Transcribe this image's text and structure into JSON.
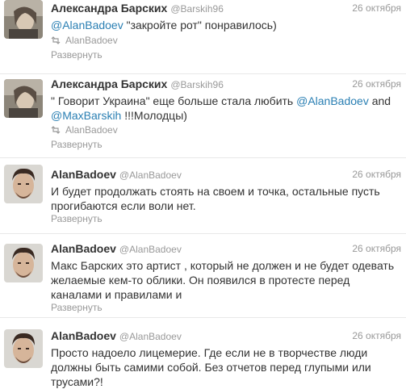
{
  "tweets": [
    {
      "author": "Александра Барских",
      "handle": "@Barskih96",
      "date": "26 октября",
      "text": [
        {
          "t": "@AlanBadoev",
          "mention": true
        },
        {
          "t": " \"закройте рот\" понравилось)",
          "mention": false
        }
      ],
      "retweeted_by": "AlanBadoev",
      "expand": "Развернуть",
      "avatar": "girl-avatar"
    },
    {
      "author": "Александра Барских",
      "handle": "@Barskih96",
      "date": "26 октября",
      "text": [
        {
          "t": "\" Говорит Украина\" еще больше стала любить ",
          "mention": false
        },
        {
          "t": "@AlanBadoev",
          "mention": true
        },
        {
          "t": " and ",
          "mention": false
        },
        {
          "t": "@MaxBarskih",
          "mention": true
        },
        {
          "t": " !!!Молодцы)",
          "mention": false
        }
      ],
      "retweeted_by": "AlanBadoev",
      "expand": "Развернуть",
      "avatar": "girl-avatar"
    },
    {
      "author": "AlanBadoev",
      "handle": "@AlanBadoev",
      "date": "26 октября",
      "text": [
        {
          "t": "И будет продолжать стоять на своем и точка, остальные пусть прогибаются если воли нет.",
          "mention": false
        }
      ],
      "expand": "Развернуть",
      "avatar": "man-avatar"
    },
    {
      "author": "AlanBadoev",
      "handle": "@AlanBadoev",
      "date": "26 октября",
      "text": [
        {
          "t": "Макс Барских это артист , который не должен и не будет одевать желаемые кем-то облики. Он появился в протесте перед каналами и правилами и",
          "mention": false
        }
      ],
      "expand": "Развернуть",
      "avatar": "man-avatar"
    },
    {
      "author": "AlanBadoev",
      "handle": "@AlanBadoev",
      "date": "26 октября",
      "text": [
        {
          "t": "Просто надоело лицемерие. Где если не в творчестве люди должны быть самими собой. Без отчетов перед глупыми или трусами?!",
          "mention": false
        }
      ],
      "avatar": "man-avatar"
    }
  ]
}
